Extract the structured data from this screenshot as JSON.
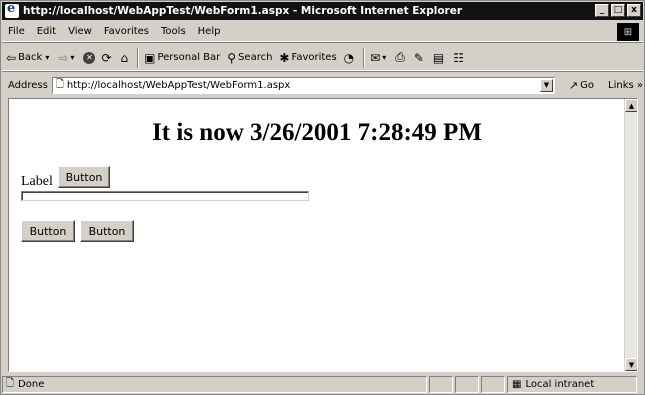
{
  "window": {
    "title": "http://localhost/WebAppTest/WebForm1.aspx - Microsoft Internet Explorer",
    "controls": {
      "minimize": "_",
      "maximize": "□",
      "close": "x"
    }
  },
  "menu": {
    "items": [
      "File",
      "Edit",
      "View",
      "Favorites",
      "Tools",
      "Help"
    ]
  },
  "toolbar": {
    "back_label": "Back",
    "personal_bar_label": "Personal Bar",
    "search_label": "Search",
    "favorites_label": "Favorites"
  },
  "address": {
    "label": "Address",
    "url": "http://localhost/WebAppTest/WebForm1.aspx",
    "go_label": "Go",
    "links_label": "Links »"
  },
  "page": {
    "heading": "It is now 3/26/2001 7:28:49 PM",
    "label_text": "Label",
    "button1_label": "Button",
    "textbox_value": "",
    "button2_label": "Button",
    "button3_label": "Button"
  },
  "status": {
    "text": "Done",
    "zone": "Local intranet"
  },
  "icons": {
    "ie": "internet-explorer-icon",
    "back": "back-arrow-icon",
    "forward": "forward-arrow-icon",
    "stop": "stop-icon",
    "refresh": "refresh-icon",
    "home": "home-icon",
    "search": "search-icon",
    "favorites": "favorites-icon",
    "history": "history-icon",
    "mail": "mail-icon",
    "print": "print-icon",
    "edit": "edit-icon",
    "discuss": "discuss-icon",
    "messenger": "messenger-icon",
    "go": "go-arrow-icon",
    "page": "page-icon",
    "zone": "intranet-zone-icon"
  }
}
